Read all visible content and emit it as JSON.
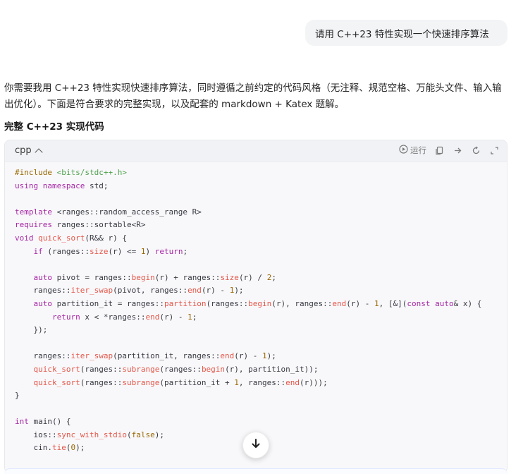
{
  "user_message": "请用 C++23 特性实现一个快速排序算法",
  "answer": {
    "intro": "你需要我用 C++23 特性实现快速排序算法，同时遵循之前约定的代码风格（无注释、规范空格、万能头文件、输入输出优化）。下面是符合要求的完整实现，以及配套的 markdown + Katex 题解。",
    "section_title": "完整 C++23 实现代码"
  },
  "code_block": {
    "language": "cpp",
    "run_label": "运行",
    "icons": [
      "play-circle-icon",
      "copy-icon",
      "share-icon",
      "refresh-icon",
      "expand-icon"
    ],
    "lines": [
      "#include <bits/stdc++.h>",
      "using namespace std;",
      "",
      "template <ranges::random_access_range R>",
      "requires ranges::sortable<R>",
      "void quick_sort(R&& r) {",
      "    if (ranges::size(r) <= 1) return;",
      "",
      "    auto pivot = ranges::begin(r) + ranges::size(r) / 2;",
      "    ranges::iter_swap(pivot, ranges::end(r) - 1);",
      "    auto partition_it = ranges::partition(ranges::begin(r), ranges::end(r) - 1, [&](const auto& x) {",
      "        return x < *ranges::end(r) - 1;",
      "    });",
      "",
      "    ranges::iter_swap(partition_it, ranges::end(r) - 1);",
      "    quick_sort(ranges::subrange(ranges::begin(r), partition_it));",
      "    quick_sort(ranges::subrange(partition_it + 1, ranges::end(r)));",
      "}",
      "",
      "int main() {",
      "    ios::sync_with_stdio(false);",
      "    cin.tie(0);"
    ]
  },
  "colors": {
    "keyword": "#a626a4",
    "function": "#e45649",
    "number": "#986801",
    "string": "#50a14f",
    "text": "#383a42"
  }
}
